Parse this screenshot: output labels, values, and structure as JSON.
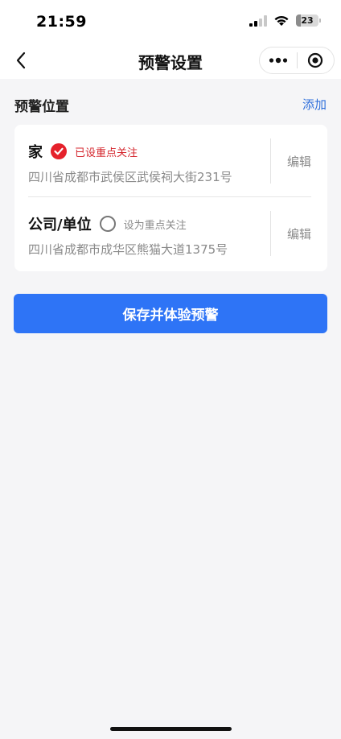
{
  "status_bar": {
    "time": "21:59",
    "battery_level": "23",
    "icons": [
      "cellular-signal-icon",
      "wifi-icon",
      "battery-icon"
    ]
  },
  "nav": {
    "title": "预警设置",
    "back_icon": "chevron-left-icon",
    "more_icon": "more-dots-icon",
    "close_icon": "target-close-icon"
  },
  "section": {
    "title": "预警位置",
    "add_label": "添加"
  },
  "locations": [
    {
      "name": "家",
      "focus_status": "已设重点关注",
      "is_focus": true,
      "address": "四川省成都市武侯区武侯祠大街231号",
      "edit_label": "编辑"
    },
    {
      "name": "公司/单位",
      "focus_status": "设为重点关注",
      "is_focus": false,
      "address": "四川省成都市成华区熊猫大道1375号",
      "edit_label": "编辑"
    }
  ],
  "actions": {
    "save_label": "保存并体验预警"
  },
  "colors": {
    "primary": "#2e74f6",
    "link": "#2f6fdb",
    "focus_red": "#e5212b",
    "muted_text": "#8a8a8a",
    "background": "#f5f5f7"
  }
}
